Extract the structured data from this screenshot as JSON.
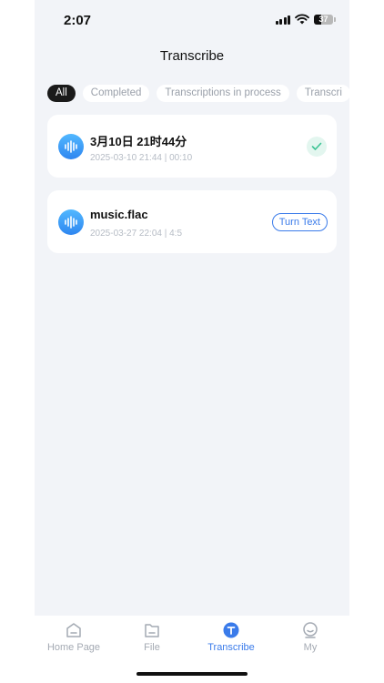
{
  "status_bar": {
    "time": "2:07",
    "battery": "37",
    "battery_level": 0.37
  },
  "header": {
    "title": "Transcribe"
  },
  "filters": {
    "all": "All",
    "completed": "Completed",
    "in_process": "Transcriptions in process",
    "next": "Transcri"
  },
  "recordings": [
    {
      "title": "3月10日 21时44分",
      "meta": "2025-03-10 21:44 | 00:10",
      "status_icon": "check-icon"
    },
    {
      "title": "music.flac",
      "meta": "2025-03-27 22:04 | 4:5",
      "action": "Turn Text"
    }
  ],
  "tabbar": {
    "home": "Home Page",
    "file": "File",
    "transcribe": "Transcribe",
    "my": "My"
  },
  "colors": {
    "accent": "#3a7bea",
    "background": "#f2f4f8",
    "success": "#3cc494"
  }
}
